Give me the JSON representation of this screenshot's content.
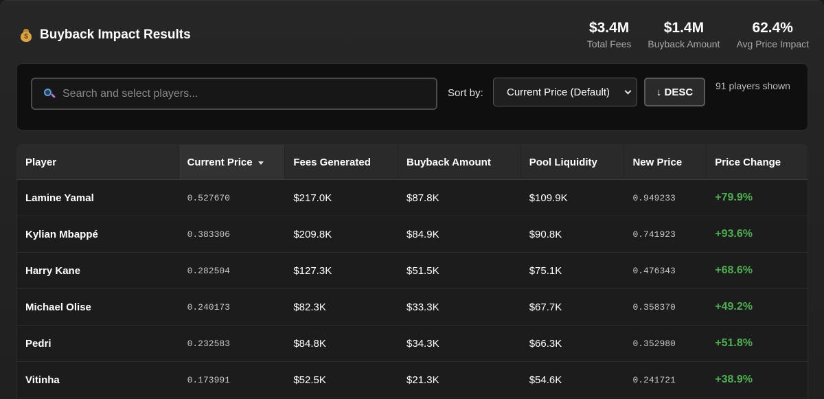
{
  "header": {
    "icon": "money-bag-icon",
    "title": "Buyback Impact Results"
  },
  "stats": [
    {
      "value": "$3.4M",
      "label": "Total Fees"
    },
    {
      "value": "$1.4M",
      "label": "Buyback Amount"
    },
    {
      "value": "62.4%",
      "label": "Avg Price Impact"
    }
  ],
  "controls": {
    "search_placeholder": "Search and select players...",
    "sort_label": "Sort by:",
    "sort_selected": "Current Price (Default)",
    "direction_label": "↓ DESC",
    "players_shown": "91 players shown"
  },
  "table": {
    "columns": [
      "Player",
      "Current Price",
      "Fees Generated",
      "Buyback Amount",
      "Pool Liquidity",
      "New Price",
      "Price Change"
    ],
    "rows": [
      [
        "Lamine Yamal",
        "0.527670",
        "$217.0K",
        "$87.8K",
        "$109.9K",
        "0.949233",
        "+79.9%"
      ],
      [
        "Kylian Mbappé",
        "0.383306",
        "$209.8K",
        "$84.9K",
        "$90.8K",
        "0.741923",
        "+93.6%"
      ],
      [
        "Harry Kane",
        "0.282504",
        "$127.3K",
        "$51.5K",
        "$75.1K",
        "0.476343",
        "+68.6%"
      ],
      [
        "Michael Olise",
        "0.240173",
        "$82.3K",
        "$33.3K",
        "$67.7K",
        "0.358370",
        "+49.2%"
      ],
      [
        "Pedri",
        "0.232583",
        "$84.8K",
        "$34.3K",
        "$66.3K",
        "0.352980",
        "+51.8%"
      ],
      [
        "Vitinha",
        "0.173991",
        "$52.5K",
        "$21.3K",
        "$54.6K",
        "0.241721",
        "+38.9%"
      ]
    ]
  },
  "colors": {
    "positive": "#4caf50",
    "background": "#1b1b1b"
  }
}
